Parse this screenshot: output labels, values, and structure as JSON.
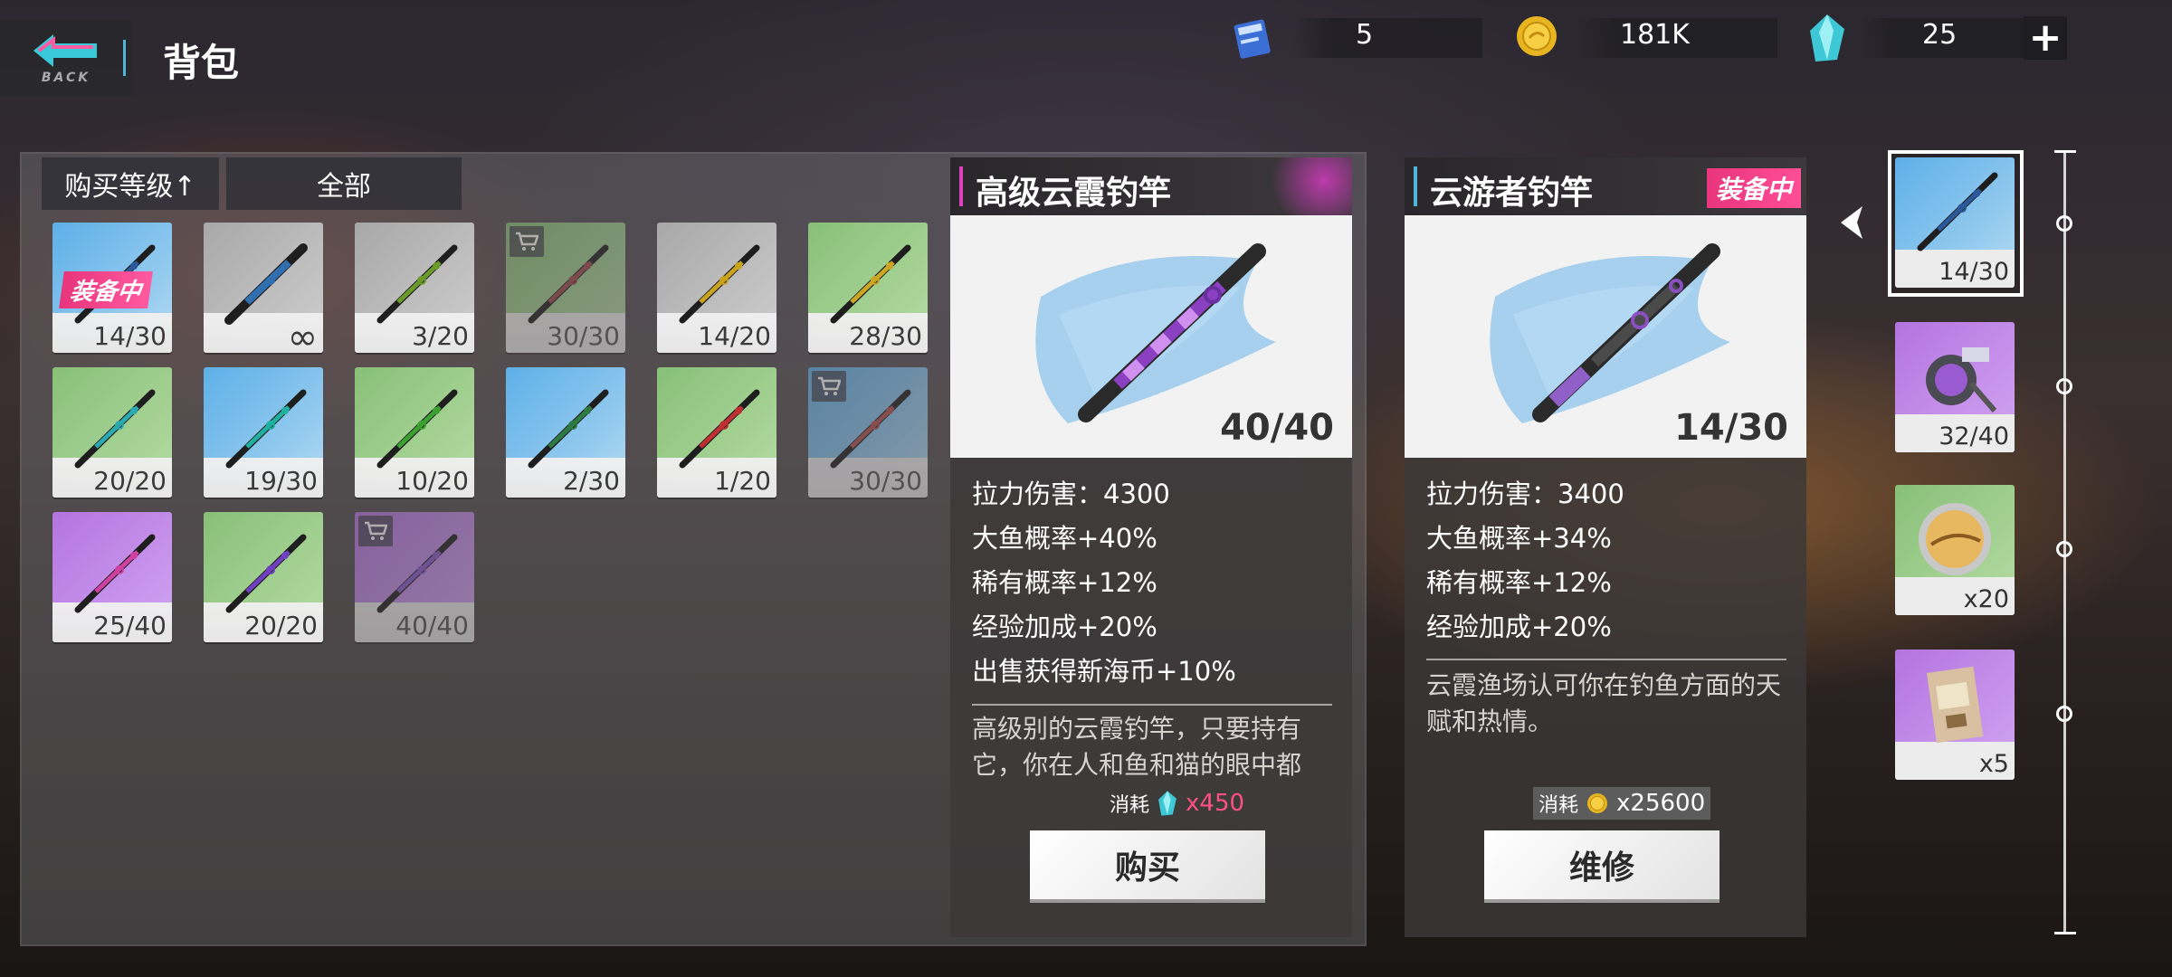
{
  "header": {
    "back_label": "BACK",
    "title": "背包"
  },
  "resources": {
    "ticket": {
      "icon": "ticket-icon",
      "value": "5"
    },
    "coin": {
      "icon": "coin-icon",
      "value": "181K"
    },
    "crystal": {
      "icon": "crystal-icon",
      "value": "25"
    },
    "plus_label": "+"
  },
  "filters": {
    "sort_label": "购买等级↑",
    "category_label": "全部"
  },
  "inventory": [
    {
      "count": "14/30",
      "bg": "blue",
      "rod_color": "#2a5a9a",
      "equipped": true,
      "shop": false,
      "dim": false
    },
    {
      "count": "∞",
      "bg": "gray",
      "rod_color": "#2f6fb0",
      "equipped": false,
      "shop": false,
      "dim": false
    },
    {
      "count": "3/20",
      "bg": "gray",
      "rod_color": "#6a9a2a",
      "equipped": false,
      "shop": false,
      "dim": false
    },
    {
      "count": "30/30",
      "bg": "green",
      "rod_color": "#a04a4a",
      "equipped": false,
      "shop": true,
      "dim": true
    },
    {
      "count": "14/20",
      "bg": "gray",
      "rod_color": "#c9a21e",
      "equipped": false,
      "shop": false,
      "dim": false
    },
    {
      "count": "28/30",
      "bg": "green",
      "rod_color": "#caa624",
      "equipped": false,
      "shop": false,
      "dim": false
    },
    {
      "count": "20/20",
      "bg": "green",
      "rod_color": "#2aaab0",
      "equipped": false,
      "shop": false,
      "dim": false
    },
    {
      "count": "19/30",
      "bg": "blue",
      "rod_color": "#1fb0a0",
      "equipped": false,
      "shop": false,
      "dim": false
    },
    {
      "count": "10/20",
      "bg": "green",
      "rod_color": "#3aa030",
      "equipped": false,
      "shop": false,
      "dim": false
    },
    {
      "count": "2/30",
      "bg": "blue",
      "rod_color": "#2e7a44",
      "equipped": false,
      "shop": false,
      "dim": false
    },
    {
      "count": "1/20",
      "bg": "green",
      "rod_color": "#c03030",
      "equipped": false,
      "shop": false,
      "dim": false
    },
    {
      "count": "30/30",
      "bg": "blue",
      "rod_color": "#b05050",
      "equipped": false,
      "shop": true,
      "dim": true
    },
    {
      "count": "25/40",
      "bg": "purple",
      "rod_color": "#d040a0",
      "equipped": false,
      "shop": false,
      "dim": false
    },
    {
      "count": "20/20",
      "bg": "green",
      "rod_color": "#7040c0",
      "equipped": false,
      "shop": false,
      "dim": false
    },
    {
      "count": "40/40",
      "bg": "purple",
      "rod_color": "#8a5ad0",
      "equipped": false,
      "shop": true,
      "dim": true
    }
  ],
  "selected_item": {
    "name": "高级云霞钓竿",
    "durability": "40/40",
    "stats": [
      "拉力伤害：4300",
      "大鱼概率+40%",
      "稀有概率+12%",
      "经验加成+20%",
      "出售获得新海币+10%"
    ],
    "description": "高级别的云霞钓竿，只要持有它，你在人和鱼和猫的眼中都",
    "cost_label": "消耗",
    "cost_value": "x450",
    "cost_icon": "crystal-icon",
    "button_label": "购买",
    "accent": "#e040c0"
  },
  "equipped_item": {
    "name": "云游者钓竿",
    "tag": "装备中",
    "durability": "14/30",
    "stats": [
      "拉力伤害：3400",
      "大鱼概率+34%",
      "稀有概率+12%",
      "经验加成+20%"
    ],
    "description": "云霞渔场认可你在钓鱼方面的天赋和热情。",
    "cost_label": "消耗",
    "cost_value": "x25600",
    "cost_icon": "coin-icon",
    "button_label": "维修",
    "accent": "#4fb5d8"
  },
  "loadout": [
    {
      "kind": "rod",
      "count": "14/30",
      "bg": "blue",
      "selected": true
    },
    {
      "kind": "reel",
      "count": "32/40",
      "bg": "purple",
      "selected": false
    },
    {
      "kind": "line",
      "count": "x20",
      "bg": "green",
      "selected": false
    },
    {
      "kind": "bait",
      "count": "x5",
      "bg": "purple",
      "selected": false
    }
  ]
}
